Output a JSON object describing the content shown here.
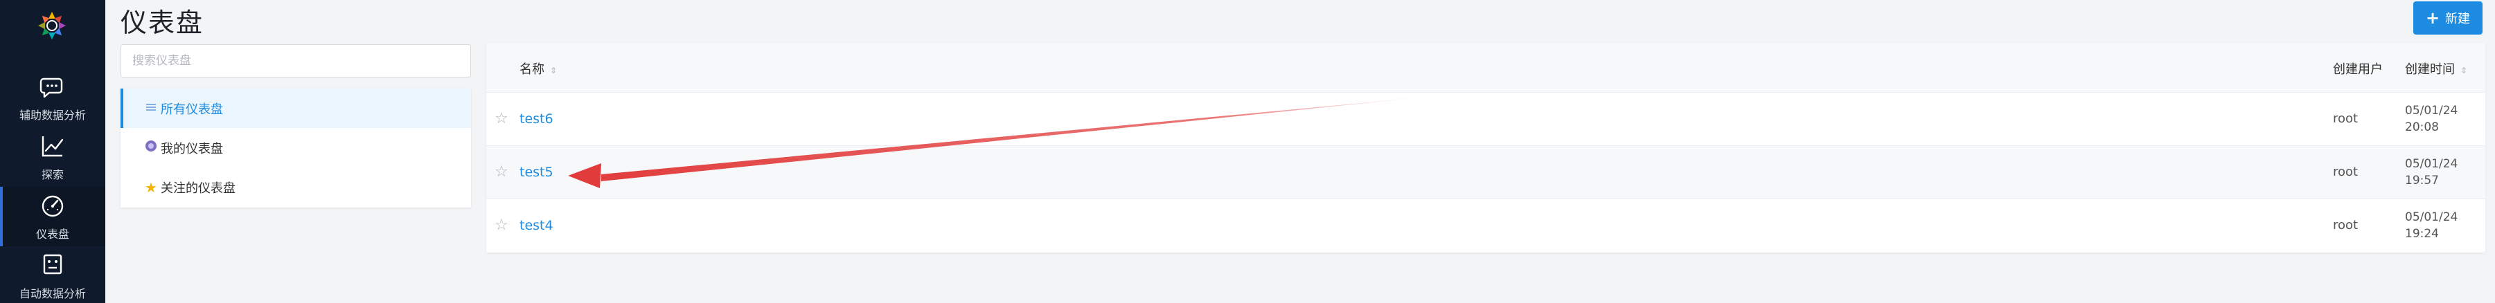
{
  "page": {
    "title": "仪表盘",
    "new_button": "新建"
  },
  "nav": {
    "items": [
      {
        "label": "辅助数据分析",
        "icon": "chat-bubble-icon"
      },
      {
        "label": "探索",
        "icon": "line-chart-icon"
      },
      {
        "label": "仪表盘",
        "icon": "gauge-icon"
      },
      {
        "label": "自动数据分析",
        "icon": "robot-icon"
      }
    ]
  },
  "search": {
    "placeholder": "搜索仪表盘",
    "value": ""
  },
  "filters": [
    {
      "label": "所有仪表盘",
      "icon": "list-icon",
      "active": true
    },
    {
      "label": "我的仪表盘",
      "icon": "avatar-icon",
      "active": false
    },
    {
      "label": "关注的仪表盘",
      "icon": "star-icon",
      "active": false
    }
  ],
  "table": {
    "columns": {
      "name": "名称",
      "creator": "创建用户",
      "created_at": "创建时间"
    },
    "rows": [
      {
        "name": "test6",
        "creator": "root",
        "date": "05/01/24",
        "time": "20:08"
      },
      {
        "name": "test5",
        "creator": "root",
        "date": "05/01/24",
        "time": "19:57"
      },
      {
        "name": "test4",
        "creator": "root",
        "date": "05/01/24",
        "time": "19:24"
      }
    ]
  },
  "colors": {
    "accent": "#1d8ce0",
    "sidebar": "#0f1b2c",
    "annotation_arrow": "#e23b3b"
  }
}
